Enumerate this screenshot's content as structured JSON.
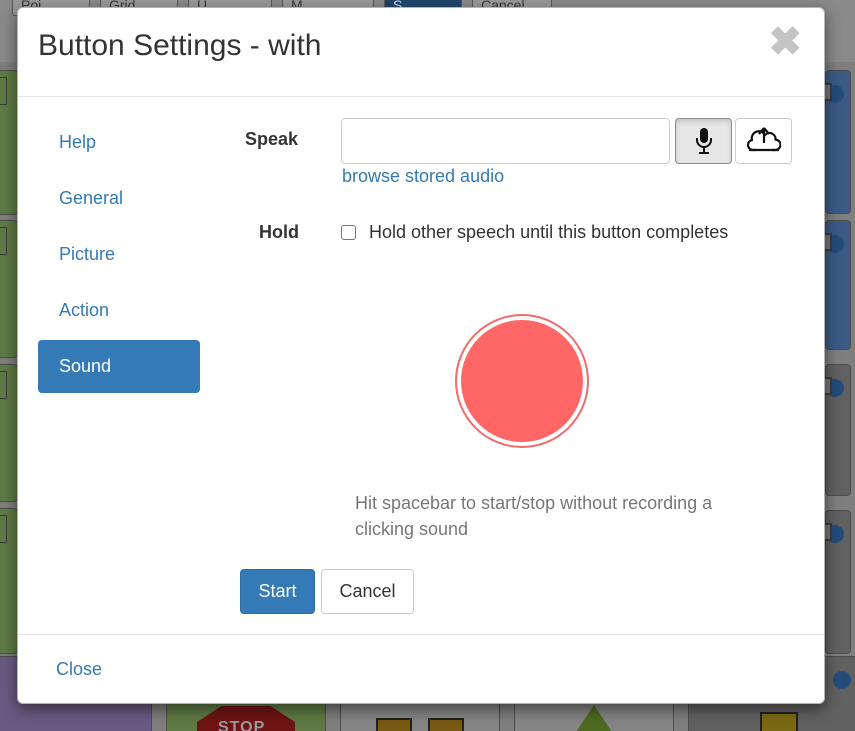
{
  "background": {
    "tabs": [
      {
        "label": "Poi",
        "active": false
      },
      {
        "label": "Grid",
        "active": false
      },
      {
        "label": "U",
        "active": false
      },
      {
        "label": "M",
        "active": false
      },
      {
        "label": "S",
        "active": true
      },
      {
        "label": "Cancel",
        "active": false
      }
    ],
    "stop_sign_text": "STOP"
  },
  "modal": {
    "title": "Button Settings - with",
    "close_icon": "close-icon"
  },
  "sidenav": {
    "items": [
      {
        "label": "Help",
        "active": false
      },
      {
        "label": "General",
        "active": false
      },
      {
        "label": "Picture",
        "active": false
      },
      {
        "label": "Action",
        "active": false
      },
      {
        "label": "Sound",
        "active": true
      }
    ]
  },
  "speak": {
    "label": "Speak",
    "value": "",
    "placeholder": "",
    "mic_icon": "microphone-icon",
    "upload_icon": "upload-cloud-icon",
    "browse_link": "browse stored audio"
  },
  "hold": {
    "label": "Hold",
    "checkbox_label": "Hold other speech until this button completes",
    "checked": false
  },
  "recorder": {
    "hint": "Hit spacebar to start/stop without recording a clicking sound",
    "color": "#ff6666"
  },
  "actions": {
    "start_label": "Start",
    "cancel_label": "Cancel"
  },
  "footer": {
    "close_label": "Close"
  },
  "colors": {
    "primary": "#337ab7",
    "record": "#ff6666",
    "text": "#333333",
    "muted": "#777777"
  }
}
